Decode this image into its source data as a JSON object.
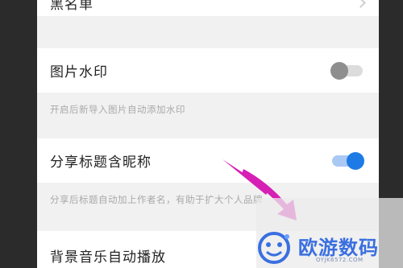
{
  "settings": {
    "blacklist": {
      "label": "黑名单"
    },
    "image_watermark": {
      "label": "图片水印",
      "enabled": false,
      "description": "开启后新导入图片自动添加水印"
    },
    "share_title_nickname": {
      "label": "分享标题含昵称",
      "enabled": true,
      "description": "分享后标题自动加上作者名，有助于扩大个人品牌"
    },
    "bg_music_autoplay": {
      "label": "背景音乐自动播放"
    }
  },
  "watermark": {
    "brand": "欧游数码",
    "url": "OYJK6572.COM"
  },
  "colors": {
    "toggle_on": "#1e7be6",
    "toggle_off": "#8e8e8e",
    "arrow": "#d61fb4",
    "brand": "#3a6fe0"
  }
}
